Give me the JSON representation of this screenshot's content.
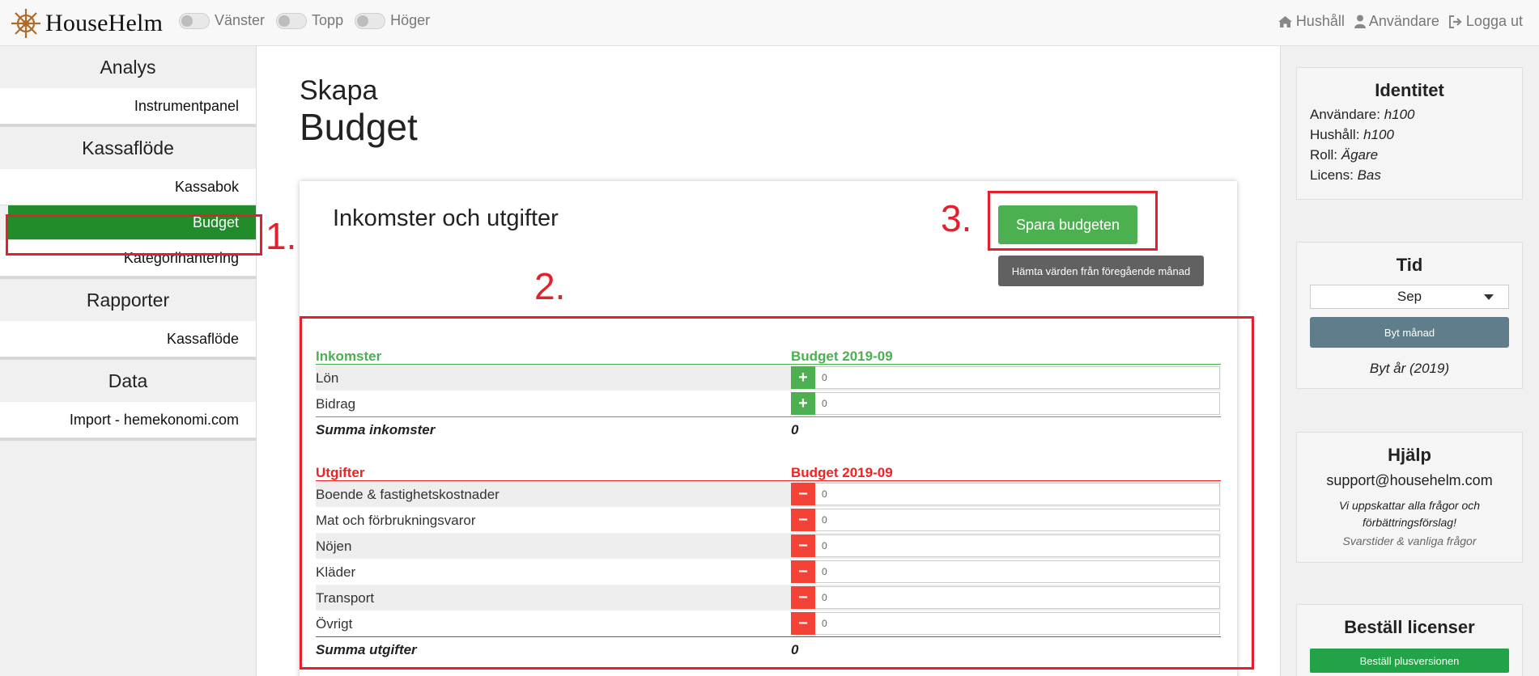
{
  "topbar": {
    "brand": "HouseHelm",
    "toggles": [
      {
        "label": "Vänster"
      },
      {
        "label": "Topp"
      },
      {
        "label": "Höger"
      }
    ],
    "nav": [
      {
        "label": "Hushåll",
        "icon": "home-icon"
      },
      {
        "label": "Användare",
        "icon": "user-icon"
      },
      {
        "label": "Logga ut",
        "icon": "sign-out-icon"
      }
    ]
  },
  "sidebar": {
    "sections": [
      {
        "title": "Analys",
        "items": [
          "Instrumentpanel"
        ]
      },
      {
        "title": "Kassaflöde",
        "items": [
          "Kassabok",
          "Budget",
          "Kategorihantering"
        ],
        "active": "Budget"
      },
      {
        "title": "Rapporter",
        "items": [
          "Kassaflöde"
        ]
      },
      {
        "title": "Data",
        "items": [
          "Import - hemekonomi.com"
        ]
      }
    ]
  },
  "main": {
    "page_title_small": "Skapa",
    "page_title_big": "Budget",
    "card_title": "Inkomster och utgifter",
    "save_button": "Spara budgeten",
    "fetch_button": "Hämta värden från föregående månad",
    "income": {
      "header": "Inkomster",
      "budget_header": "Budget 2019-09",
      "rows": [
        {
          "label": "Lön",
          "value": "0"
        },
        {
          "label": "Bidrag",
          "value": "0"
        }
      ],
      "sum_label": "Summa inkomster",
      "sum_value": "0"
    },
    "expenses": {
      "header": "Utgifter",
      "budget_header": "Budget 2019-09",
      "rows": [
        {
          "label": "Boende & fastighetskostnader",
          "value": "0"
        },
        {
          "label": "Mat och förbrukningsvaror",
          "value": "0"
        },
        {
          "label": "Nöjen",
          "value": "0"
        },
        {
          "label": "Kläder",
          "value": "0"
        },
        {
          "label": "Transport",
          "value": "0"
        },
        {
          "label": "Övrigt",
          "value": "0"
        }
      ],
      "sum_label": "Summa utgifter",
      "sum_value": "0"
    }
  },
  "right": {
    "identity": {
      "title": "Identitet",
      "lines": [
        {
          "key": "Användare: ",
          "value": "h100"
        },
        {
          "key": "Hushåll: ",
          "value": "h100"
        },
        {
          "key": "Roll: ",
          "value": "Ägare"
        },
        {
          "key": "Licens: ",
          "value": "Bas"
        }
      ]
    },
    "time": {
      "title": "Tid",
      "selected_month": "Sep",
      "change_button": "Byt månad",
      "year_link": "Byt år (2019)"
    },
    "help": {
      "title": "Hjälp",
      "email": "support@househelm.com",
      "text": "Vi uppskattar alla frågor och förbättringsförslag!",
      "link": "Svarstider & vanliga frågor"
    },
    "order": {
      "title": "Beställ licenser",
      "button": "Beställ plusversionen"
    }
  },
  "annotations": [
    "1.",
    "2.",
    "3."
  ],
  "colors": {
    "active_green": "#218c2a",
    "income_green": "#4caf50",
    "expense_red": "#f02222",
    "annotation_red": "#e3202b"
  }
}
